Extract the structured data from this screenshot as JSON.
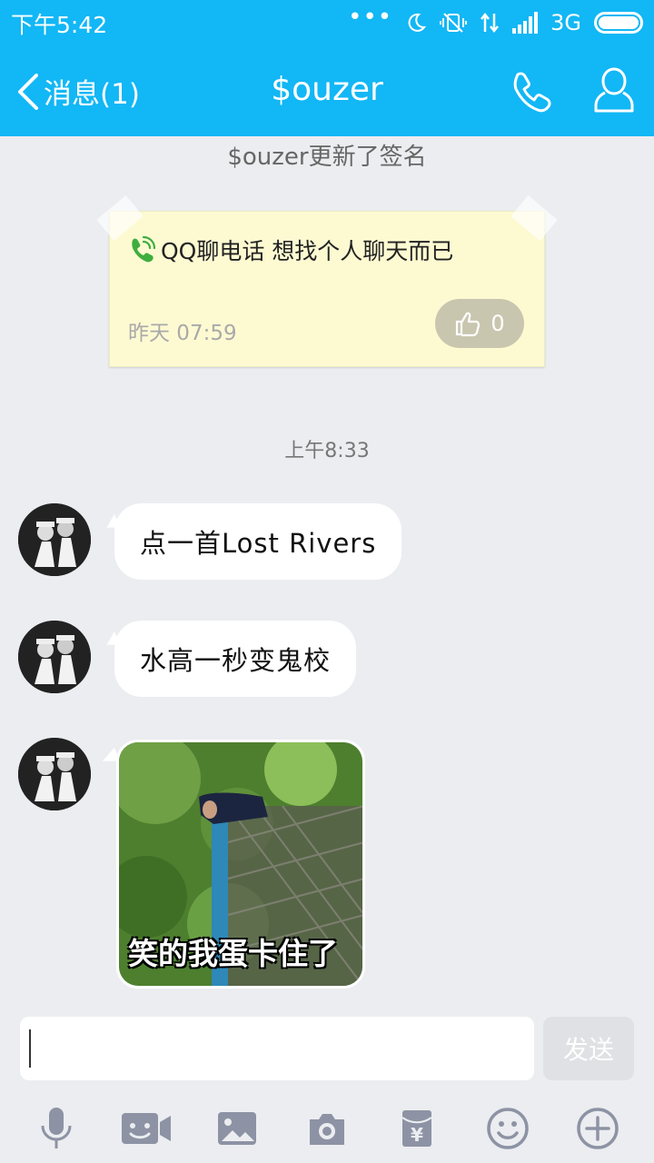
{
  "status_bar": {
    "time": "下午5:42",
    "network": "3G"
  },
  "header": {
    "back_label": "消息(1)",
    "title": "$ouzer"
  },
  "signature": {
    "update_text": "$ouzer更新了签名",
    "text": "QQ聊电话 想找个人聊天而已",
    "time": "昨天 07:59",
    "likes": "0"
  },
  "chat": {
    "time_separator": "上午8:33",
    "messages": [
      {
        "text": "点一首Lost Rivers"
      },
      {
        "text": "水高一秒变鬼校"
      }
    ],
    "image_caption": "笑的我蛋卡住了"
  },
  "composer": {
    "input_value": "",
    "send_label": "发送"
  },
  "colors": {
    "accent": "#12b7f5",
    "background": "#ebedf0",
    "note": "#fdfad2"
  }
}
